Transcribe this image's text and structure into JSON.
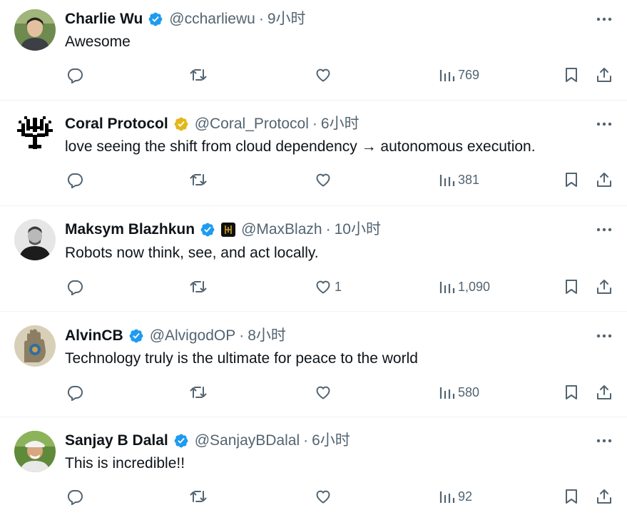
{
  "tweets": [
    {
      "name": "Charlie Wu",
      "handle": "@ccharliewu",
      "dot": "·",
      "time": "9小时",
      "text": "Awesome",
      "likes": "",
      "views": "769",
      "verified": "blue-check"
    },
    {
      "name": "Coral Protocol",
      "handle": "@Coral_Protocol",
      "dot": "·",
      "time": "6小时",
      "text": "love seeing the shift from cloud dependency → autonomous execution.",
      "likes": "",
      "views": "381",
      "verified": "gold-check"
    },
    {
      "name": "Maksym Blazhkun",
      "handle": "@MaxBlazh",
      "dot": "·",
      "time": "10小时",
      "text": "Robots now think, see, and act locally.",
      "likes": "1",
      "views": "1,090",
      "verified": "blue-check"
    },
    {
      "name": "AlvinCB",
      "handle": "@AlvigodOP",
      "dot": "·",
      "time": "8小时",
      "text": "Technology truly is the ultimate for peace to the world",
      "likes": "",
      "views": "580",
      "verified": "blue-check"
    },
    {
      "name": "Sanjay B Dalal",
      "handle": "@SanjayBDalal",
      "dot": "·",
      "time": "6小时",
      "text": "This is incredible!!",
      "likes": "",
      "views": "92",
      "verified": "blue-check"
    }
  ],
  "colors": {
    "verified_blue": "#1d9bf0",
    "verified_gold": "#e2b719",
    "muted": "#536471",
    "text": "#0f1419"
  }
}
